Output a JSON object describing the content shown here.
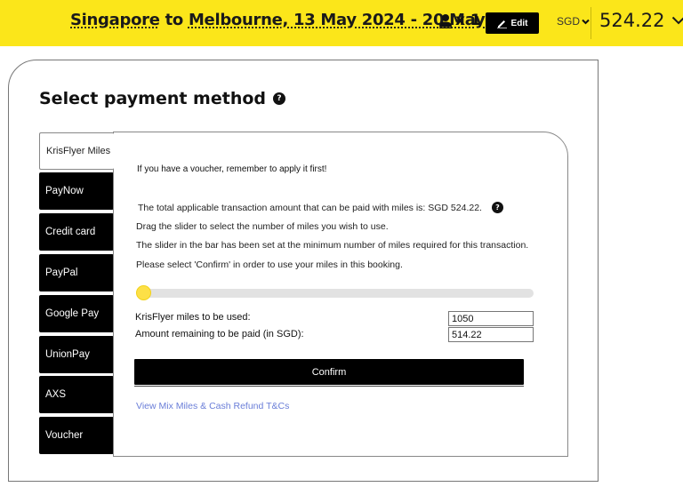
{
  "header": {
    "origin": "Singapore",
    "connector": "to",
    "destination_dates": "Melbourne, 13 May 2024 - 20 May 2024",
    "pax_count": "x 1",
    "edit_label": "Edit",
    "currency": "SGD",
    "total": "524.22",
    "accent_color": "#fbe61a"
  },
  "page": {
    "title": "Select payment method",
    "help_glyph": "?"
  },
  "tabs": [
    {
      "label": "KrisFlyer Miles",
      "active": true
    },
    {
      "label": "PayNow",
      "active": false
    },
    {
      "label": "Credit card",
      "active": false
    },
    {
      "label": "PayPal",
      "active": false
    },
    {
      "label": "Google Pay",
      "active": false
    },
    {
      "label": "UnionPay",
      "active": false
    },
    {
      "label": "AXS",
      "active": false
    },
    {
      "label": "Voucher",
      "active": false
    }
  ],
  "miles": {
    "voucher_note": "If you have a voucher, remember to apply it first!",
    "applicable_text": "The total applicable transaction amount that can be paid with miles is: SGD 524.22.",
    "instruction_1": "Drag the slider to select the number of miles you wish to use.",
    "instruction_2": "The slider in the bar has been set at the minimum number of miles required for this transaction.",
    "instruction_3": "Please select 'Confirm' in order to use your miles in this booking.",
    "slider_fraction": 0.0,
    "miles_label": "KrisFlyer miles to be used:",
    "miles_value": "1050",
    "remaining_label": "Amount remaining to be paid (in SGD):",
    "remaining_value": "514.22",
    "confirm_label": "Confirm",
    "terms_link": "View Mix Miles & Cash Refund T&Cs"
  }
}
